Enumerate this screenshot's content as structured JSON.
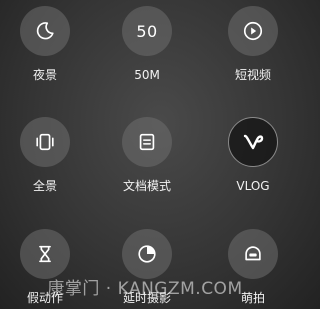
{
  "modes": [
    {
      "label": "夜景",
      "icon": "moon-icon"
    },
    {
      "label": "50M",
      "icon": "50m-icon",
      "icon_text": "50"
    },
    {
      "label": "短视频",
      "icon": "play-circle-icon"
    },
    {
      "label": "全景",
      "icon": "panorama-icon"
    },
    {
      "label": "文档模式",
      "icon": "document-icon"
    },
    {
      "label": "VLOG",
      "icon": "vlog-icon"
    },
    {
      "label": "假动作",
      "icon": "hourglass-icon"
    },
    {
      "label": "延时摄影",
      "icon": "timelapse-icon"
    },
    {
      "label": "萌拍",
      "icon": "cute-face-icon"
    }
  ],
  "watermark": "康掌门 · KANGZM.COM",
  "colors": {
    "background": "#353535",
    "button_fill": "#6e6e6e",
    "text": "#f2f2f2"
  }
}
